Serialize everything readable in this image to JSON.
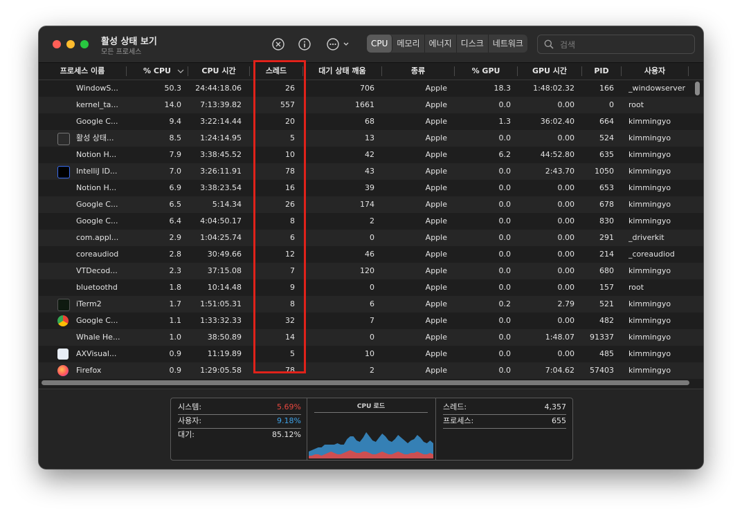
{
  "window": {
    "title": "활성 상태 보기",
    "subtitle": "모든 프로세스"
  },
  "toolbar": {
    "stop_icon": "x-circle-icon",
    "info_icon": "info-circle-icon",
    "more_icon": "ellipsis-circle-icon",
    "tabs": [
      {
        "label": "CPU",
        "active": true
      },
      {
        "label": "메모리",
        "active": false
      },
      {
        "label": "에너지",
        "active": false
      },
      {
        "label": "디스크",
        "active": false
      },
      {
        "label": "네트워크",
        "active": false
      }
    ],
    "search_placeholder": "검색"
  },
  "columns": [
    "프로세스 이름",
    "% CPU",
    "CPU 시간",
    "스레드",
    "대기 상태 깨움",
    "종류",
    "% GPU",
    "GPU 시간",
    "PID",
    "사용자"
  ],
  "rows": [
    {
      "icon": "",
      "name": "WindowS...",
      "cpu": "50.3",
      "cpu_time": "24:44:18.06",
      "threads": "26",
      "wakes": "706",
      "kind": "Apple",
      "gpu": "18.3",
      "gpu_time": "1:48:02.32",
      "pid": "166",
      "user": "_windowserver"
    },
    {
      "icon": "",
      "name": "kernel_ta...",
      "cpu": "14.0",
      "cpu_time": "7:13:39.82",
      "threads": "557",
      "wakes": "1661",
      "kind": "Apple",
      "gpu": "0.0",
      "gpu_time": "0.00",
      "pid": "0",
      "user": "root"
    },
    {
      "icon": "",
      "name": "Google C...",
      "cpu": "9.4",
      "cpu_time": "3:22:14.44",
      "threads": "20",
      "wakes": "68",
      "kind": "Apple",
      "gpu": "1.3",
      "gpu_time": "36:02.40",
      "pid": "664",
      "user": "kimmingyo"
    },
    {
      "icon": "activity-monitor-icon",
      "name": "활성 상태...",
      "cpu": "8.5",
      "cpu_time": "1:24:14.95",
      "threads": "5",
      "wakes": "13",
      "kind": "Apple",
      "gpu": "0.0",
      "gpu_time": "0.00",
      "pid": "524",
      "user": "kimmingyo"
    },
    {
      "icon": "",
      "name": "Notion H...",
      "cpu": "7.9",
      "cpu_time": "3:38:45.52",
      "threads": "10",
      "wakes": "42",
      "kind": "Apple",
      "gpu": "6.2",
      "gpu_time": "44:52.80",
      "pid": "635",
      "user": "kimmingyo"
    },
    {
      "icon": "intellij-icon",
      "name": "IntelliJ ID...",
      "cpu": "7.0",
      "cpu_time": "3:26:11.91",
      "threads": "78",
      "wakes": "43",
      "kind": "Apple",
      "gpu": "0.0",
      "gpu_time": "2:43.70",
      "pid": "1050",
      "user": "kimmingyo"
    },
    {
      "icon": "",
      "name": "Notion H...",
      "cpu": "6.9",
      "cpu_time": "3:38:23.54",
      "threads": "16",
      "wakes": "39",
      "kind": "Apple",
      "gpu": "0.0",
      "gpu_time": "0.00",
      "pid": "653",
      "user": "kimmingyo"
    },
    {
      "icon": "",
      "name": "Google C...",
      "cpu": "6.5",
      "cpu_time": "5:14.34",
      "threads": "26",
      "wakes": "174",
      "kind": "Apple",
      "gpu": "0.0",
      "gpu_time": "0.00",
      "pid": "678",
      "user": "kimmingyo"
    },
    {
      "icon": "",
      "name": "Google C...",
      "cpu": "6.4",
      "cpu_time": "4:04:50.17",
      "threads": "8",
      "wakes": "2",
      "kind": "Apple",
      "gpu": "0.0",
      "gpu_time": "0.00",
      "pid": "830",
      "user": "kimmingyo"
    },
    {
      "icon": "",
      "name": "com.appl...",
      "cpu": "2.9",
      "cpu_time": "1:04:25.74",
      "threads": "6",
      "wakes": "0",
      "kind": "Apple",
      "gpu": "0.0",
      "gpu_time": "0.00",
      "pid": "291",
      "user": "_driverkit"
    },
    {
      "icon": "",
      "name": "coreaudiod",
      "cpu": "2.8",
      "cpu_time": "30:49.66",
      "threads": "12",
      "wakes": "46",
      "kind": "Apple",
      "gpu": "0.0",
      "gpu_time": "0.00",
      "pid": "214",
      "user": "_coreaudiod"
    },
    {
      "icon": "",
      "name": "VTDecod...",
      "cpu": "2.3",
      "cpu_time": "37:15.08",
      "threads": "7",
      "wakes": "120",
      "kind": "Apple",
      "gpu": "0.0",
      "gpu_time": "0.00",
      "pid": "680",
      "user": "kimmingyo"
    },
    {
      "icon": "",
      "name": "bluetoothd",
      "cpu": "1.8",
      "cpu_time": "10:14.48",
      "threads": "9",
      "wakes": "0",
      "kind": "Apple",
      "gpu": "0.0",
      "gpu_time": "0.00",
      "pid": "157",
      "user": "root"
    },
    {
      "icon": "iterm-icon",
      "name": "iTerm2",
      "cpu": "1.7",
      "cpu_time": "1:51:05.31",
      "threads": "8",
      "wakes": "6",
      "kind": "Apple",
      "gpu": "0.2",
      "gpu_time": "2.79",
      "pid": "521",
      "user": "kimmingyo"
    },
    {
      "icon": "chrome-icon",
      "name": "Google C...",
      "cpu": "1.1",
      "cpu_time": "1:33:32.33",
      "threads": "32",
      "wakes": "7",
      "kind": "Apple",
      "gpu": "0.0",
      "gpu_time": "0.00",
      "pid": "482",
      "user": "kimmingyo"
    },
    {
      "icon": "",
      "name": "Whale He...",
      "cpu": "1.0",
      "cpu_time": "38:50.89",
      "threads": "14",
      "wakes": "0",
      "kind": "Apple",
      "gpu": "0.0",
      "gpu_time": "1:48.07",
      "pid": "91337",
      "user": "kimmingyo"
    },
    {
      "icon": "accessibility-icon",
      "name": "AXVisual...",
      "cpu": "0.9",
      "cpu_time": "11:19.89",
      "threads": "5",
      "wakes": "10",
      "kind": "Apple",
      "gpu": "0.0",
      "gpu_time": "0.00",
      "pid": "485",
      "user": "kimmingyo"
    },
    {
      "icon": "firefox-icon",
      "name": "Firefox",
      "cpu": "0.9",
      "cpu_time": "1:29:05.58",
      "threads": "78",
      "wakes": "2",
      "kind": "Apple",
      "gpu": "0.0",
      "gpu_time": "7:04.62",
      "pid": "57403",
      "user": "kimmingyo"
    }
  ],
  "footer": {
    "system_label": "시스템:",
    "system_value": "5.69%",
    "user_label": "사용자:",
    "user_value": "9.18%",
    "idle_label": "대기:",
    "idle_value": "85.12%",
    "graph_title": "CPU 로드",
    "threads_label": "스레드:",
    "threads_value": "4,357",
    "processes_label": "프로세스:",
    "processes_value": "655"
  },
  "colors": {
    "system": "#e8473f",
    "user": "#3ea2e8",
    "highlight": "#e0221a"
  },
  "cpu_load": {
    "system_pct": [
      2,
      2,
      3,
      3,
      2,
      3,
      4,
      5,
      4,
      3,
      3,
      4,
      5,
      6,
      5,
      4,
      4,
      5,
      5,
      4,
      3,
      3,
      4,
      5,
      4,
      3,
      3,
      4,
      5,
      4,
      3,
      3,
      4,
      4,
      5,
      4,
      3,
      3,
      4,
      3
    ],
    "user_pct": [
      3,
      4,
      4,
      5,
      6,
      7,
      6,
      5,
      6,
      8,
      7,
      6,
      9,
      10,
      11,
      9,
      8,
      10,
      14,
      12,
      10,
      9,
      11,
      13,
      12,
      10,
      9,
      10,
      12,
      11,
      10,
      8,
      9,
      10,
      12,
      11,
      9,
      8,
      9,
      8
    ]
  }
}
